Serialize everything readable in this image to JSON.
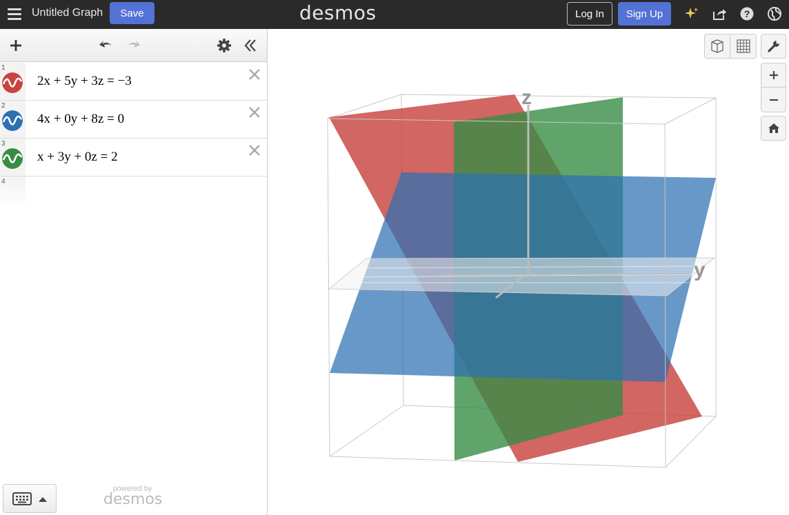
{
  "header": {
    "title": "Untitled Graph",
    "save_label": "Save",
    "logo": "desmos",
    "login_label": "Log In",
    "signup_label": "Sign Up"
  },
  "toolbar": {
    "icons": [
      "plus-icon",
      "undo-icon",
      "redo-icon",
      "gear-icon",
      "collapse-icon"
    ]
  },
  "expressions": [
    {
      "number": "1",
      "latex": "2x + 5y + 3z = −3",
      "color": "#c74440"
    },
    {
      "number": "2",
      "latex": "4x + 0y + 8z = 0",
      "color": "#2d70b3"
    },
    {
      "number": "3",
      "latex": "x + 3y + 0z = 2",
      "color": "#388c46"
    },
    {
      "number": "4",
      "latex": "",
      "color": ""
    }
  ],
  "footer": {
    "powered_by": "powered by",
    "powered_logo": "desmos"
  },
  "graph": {
    "axes": {
      "z": "z",
      "y": "y"
    },
    "zoom_in": "+",
    "zoom_out": "−"
  },
  "colors": {
    "red": "#c74440",
    "blue": "#2d70b3",
    "green": "#388c46",
    "accent": "#5472d6"
  }
}
